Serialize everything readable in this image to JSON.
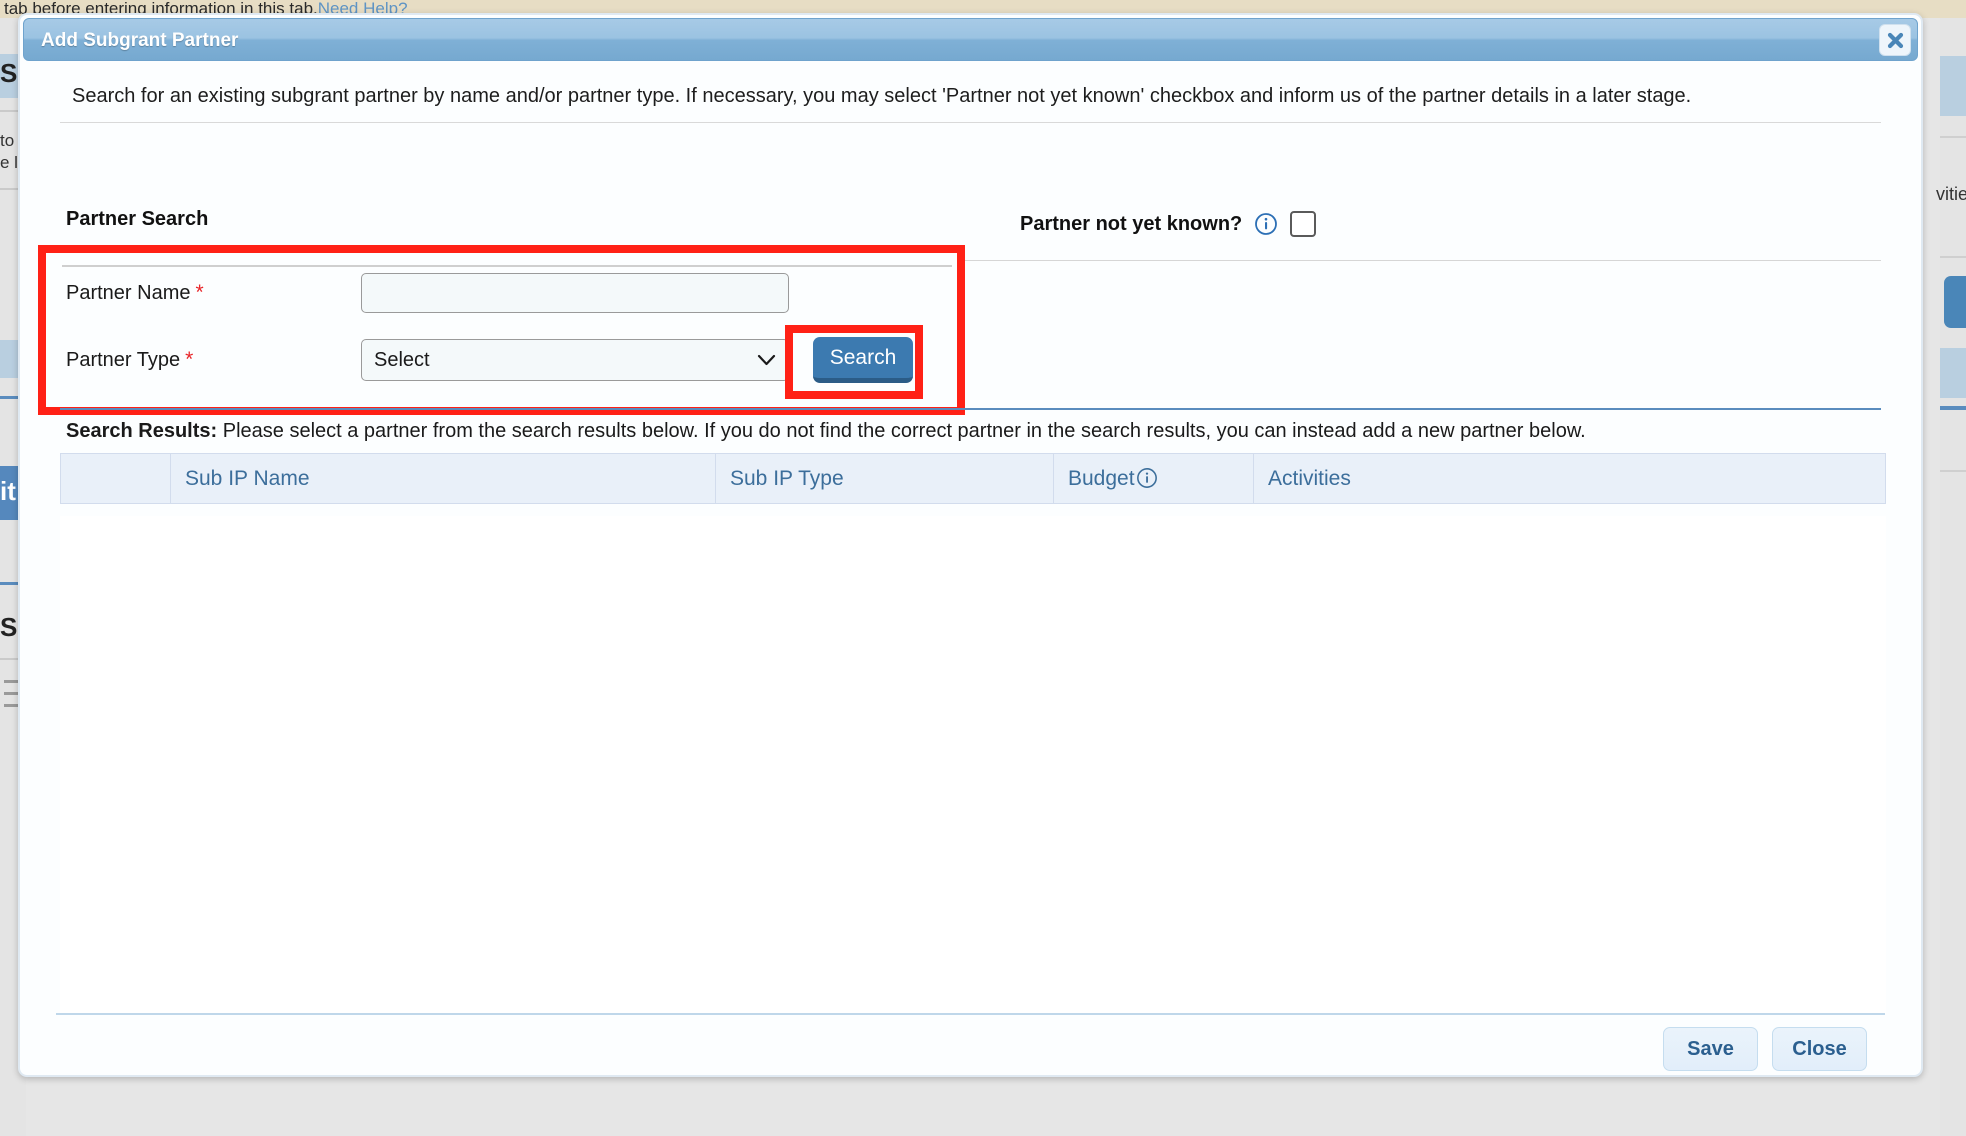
{
  "background": {
    "top_text": "tab before entering information in this tab.",
    "need_help_link": "Need Help?",
    "left_fragments": [
      "Su",
      "to",
      "e li",
      "it",
      "Su"
    ],
    "right_fragment": "vitie"
  },
  "modal": {
    "title": "Add Subgrant Partner",
    "close_icon": "close-icon",
    "intro": "Search for an existing subgrant partner by name and/or partner type. If necessary, you may select 'Partner not yet known' checkbox and inform us of the partner details in a later stage.",
    "section": {
      "label": "Partner Search",
      "partner_not_yet_known": {
        "label": "Partner not yet known?",
        "info_icon": "info-icon",
        "checked": false
      },
      "fields": [
        {
          "label": "Partner Name",
          "required": "*",
          "value": "",
          "placeholder": ""
        },
        {
          "label": "Partner Type",
          "required": "*",
          "selected": "Select",
          "options": [
            "Select"
          ]
        }
      ],
      "search_button": "Search"
    },
    "results": {
      "heading": "Search Results:",
      "description": "Please select a partner from the search results below. If you do not find the correct partner in the search results, you can instead add a new partner below.",
      "columns": [
        {
          "label": "",
          "icon": ""
        },
        {
          "label": "Sub IP Name",
          "icon": ""
        },
        {
          "label": "Sub IP Type",
          "icon": ""
        },
        {
          "label": "Budget",
          "icon": "info-icon"
        },
        {
          "label": "Activities",
          "icon": ""
        }
      ],
      "rows": []
    },
    "footer": {
      "save_label": "Save",
      "close_label": "Close"
    }
  },
  "annotations": {
    "color": "#ff2116",
    "boxes": [
      "partner-search-fields",
      "search-button"
    ]
  },
  "colors": {
    "titlebar_blue": "#9bc3e2",
    "accent_blue": "#3c7ab0",
    "table_header_bg": "#e9f0f9",
    "table_header_text": "#3c6e9b",
    "required_red": "#e8262a",
    "annotation_red": "#ff2116",
    "input_bg": "#f4f9fa"
  }
}
